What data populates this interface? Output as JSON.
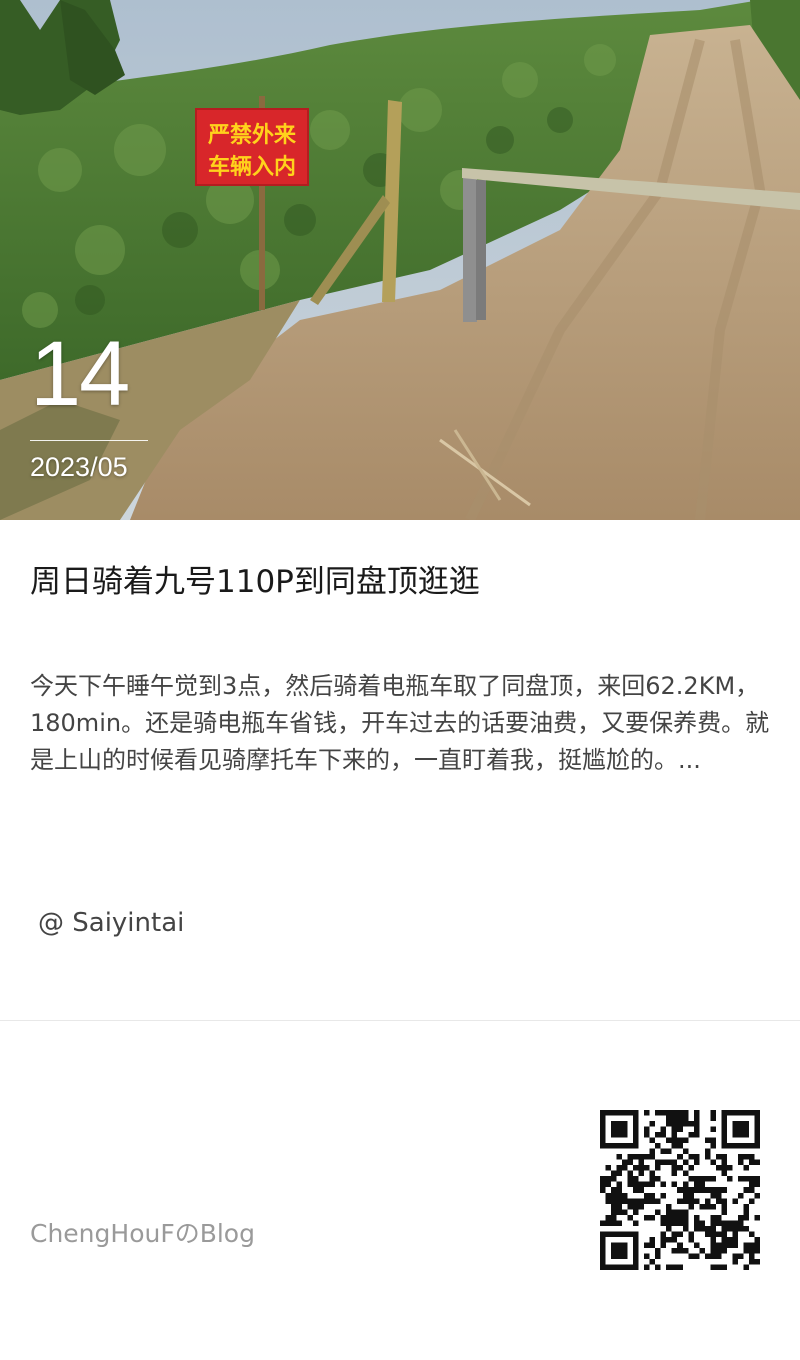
{
  "hero": {
    "day": "14",
    "month": "2023/05",
    "sign_line1": "严禁外来",
    "sign_line2": "车辆入内"
  },
  "post": {
    "title": "周日骑着九号110P到同盘顶逛逛",
    "excerpt": "今天下午睡午觉到3点，然后骑着电瓶车取了同盘顶，来回62.2KM，180min。还是骑电瓶车省钱，开车过去的话要油费，又要保养费。就是上山的时候看见骑摩托车下来的，一直盯着我，挺尴尬的。...",
    "author": "@ Saiyintai"
  },
  "footer": {
    "blog_name": "ChengHouFのBlog",
    "qr_icon": "qr-code-icon"
  },
  "colors": {
    "sign_red": "#d8262a",
    "sign_text": "#ffd21c",
    "tea_green": "#4f7a35",
    "dirt": "#b9a07c"
  }
}
